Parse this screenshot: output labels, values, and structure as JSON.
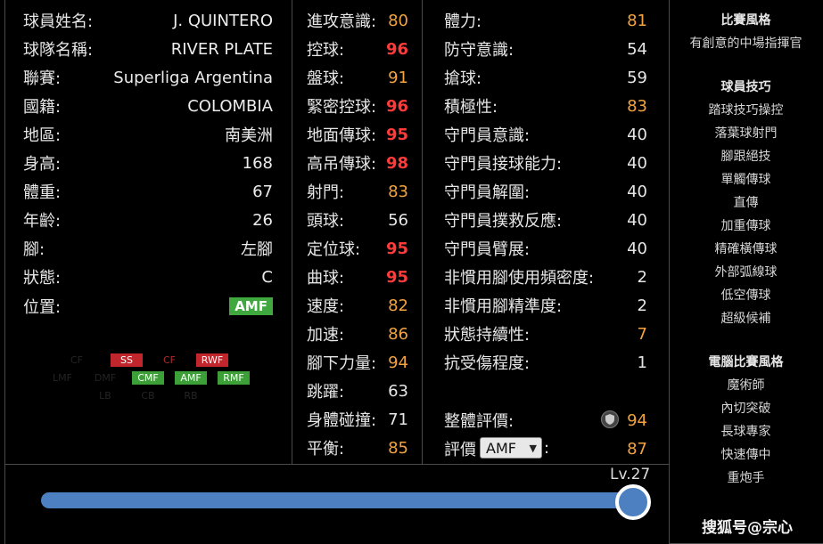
{
  "info": {
    "rows": [
      {
        "label": "球員姓名:",
        "value": "J. QUINTERO"
      },
      {
        "label": "球隊名稱:",
        "value": "RIVER PLATE"
      },
      {
        "label": "聯賽:",
        "value": "Superliga Argentina"
      },
      {
        "label": "國籍:",
        "value": "COLOMBIA"
      },
      {
        "label": "地區:",
        "value": "南美洲"
      },
      {
        "label": "身高:",
        "value": "168"
      },
      {
        "label": "體重:",
        "value": "67"
      },
      {
        "label": "年齡:",
        "value": "26"
      },
      {
        "label": "腳:",
        "value": "左腳"
      },
      {
        "label": "狀態:",
        "value": "C"
      }
    ],
    "position_label": "位置:",
    "position_value": "AMF"
  },
  "position_map": {
    "row1": [
      {
        "code": "CF",
        "state": "dim"
      },
      {
        "code": "SS",
        "state": "red"
      },
      {
        "code": "CF",
        "state": "dim-red"
      },
      {
        "code": "RWF",
        "state": "red"
      }
    ],
    "row2": [
      {
        "code": "LMF",
        "state": "dim"
      },
      {
        "code": "DMF",
        "state": "dim"
      },
      {
        "code": "CMF",
        "state": "green"
      },
      {
        "code": "AMF",
        "state": "green"
      },
      {
        "code": "RMF",
        "state": "green"
      }
    ],
    "row3": [
      {
        "code": "LB",
        "state": "dim"
      },
      {
        "code": "CB",
        "state": "dim"
      },
      {
        "code": "RB",
        "state": "dim"
      }
    ]
  },
  "attributes_left": [
    {
      "label": "進攻意識:",
      "value": "80",
      "tier": "orange"
    },
    {
      "label": "控球:",
      "value": "96",
      "tier": "red"
    },
    {
      "label": "盤球:",
      "value": "91",
      "tier": "orange"
    },
    {
      "label": "緊密控球:",
      "value": "96",
      "tier": "red"
    },
    {
      "label": "地面傳球:",
      "value": "95",
      "tier": "red"
    },
    {
      "label": "高吊傳球:",
      "value": "98",
      "tier": "red"
    },
    {
      "label": "射門:",
      "value": "83",
      "tier": "orange"
    },
    {
      "label": "頭球:",
      "value": "56",
      "tier": "white"
    },
    {
      "label": "定位球:",
      "value": "95",
      "tier": "red"
    },
    {
      "label": "曲球:",
      "value": "95",
      "tier": "red"
    },
    {
      "label": "速度:",
      "value": "82",
      "tier": "orange"
    },
    {
      "label": "加速:",
      "value": "86",
      "tier": "orange"
    },
    {
      "label": "腳下力量:",
      "value": "94",
      "tier": "orange"
    },
    {
      "label": "跳躍:",
      "value": "63",
      "tier": "white"
    },
    {
      "label": "身體碰撞:",
      "value": "71",
      "tier": "white"
    },
    {
      "label": "平衡:",
      "value": "85",
      "tier": "orange"
    }
  ],
  "attributes_right": [
    {
      "label": "體力:",
      "value": "81",
      "tier": "orange"
    },
    {
      "label": "防守意識:",
      "value": "54",
      "tier": "white"
    },
    {
      "label": "搶球:",
      "value": "59",
      "tier": "white"
    },
    {
      "label": "積極性:",
      "value": "83",
      "tier": "orange"
    },
    {
      "label": "守門員意識:",
      "value": "40",
      "tier": "white"
    },
    {
      "label": "守門員接球能力:",
      "value": "40",
      "tier": "white"
    },
    {
      "label": "守門員解圍:",
      "value": "40",
      "tier": "white"
    },
    {
      "label": "守門員撲救反應:",
      "value": "40",
      "tier": "white"
    },
    {
      "label": "守門員臂展:",
      "value": "40",
      "tier": "white"
    },
    {
      "label": "非慣用腳使用頻密度:",
      "value": "2",
      "tier": "white"
    },
    {
      "label": "非慣用腳精準度:",
      "value": "2",
      "tier": "white"
    },
    {
      "label": "狀態持續性:",
      "value": "7",
      "tier": "orange"
    },
    {
      "label": "抗受傷程度:",
      "value": "1",
      "tier": "white"
    }
  ],
  "overall": {
    "label": "整體評價:",
    "value": "94"
  },
  "rating": {
    "label": "評價",
    "select_value": "AMF",
    "colon": ":",
    "value": "87"
  },
  "level": {
    "label": "Lv.27",
    "progress": 1.0
  },
  "style_panel": {
    "playing_style_title": "比賽風格",
    "playing_style": "有創意的中場指揮官",
    "skills_title": "球員技巧",
    "skills": [
      "踏球技巧操控",
      "落葉球射門",
      "腳跟絕技",
      "單觸傳球",
      "直傳",
      "加重傳球",
      "精確橫傳球",
      "外部弧線球",
      "低空傳球",
      "超級候補"
    ],
    "com_title": "電腦比賽風格",
    "com_styles": [
      "魔術師",
      "內切突破",
      "長球專家",
      "快速傳中",
      "重炮手"
    ]
  },
  "watermark": "搜狐号@宗心",
  "colors": {
    "red": "#ff3a3a",
    "orange": "#f3a33f",
    "green_badge": "#3fa83f",
    "slider": "#4c80c1"
  }
}
